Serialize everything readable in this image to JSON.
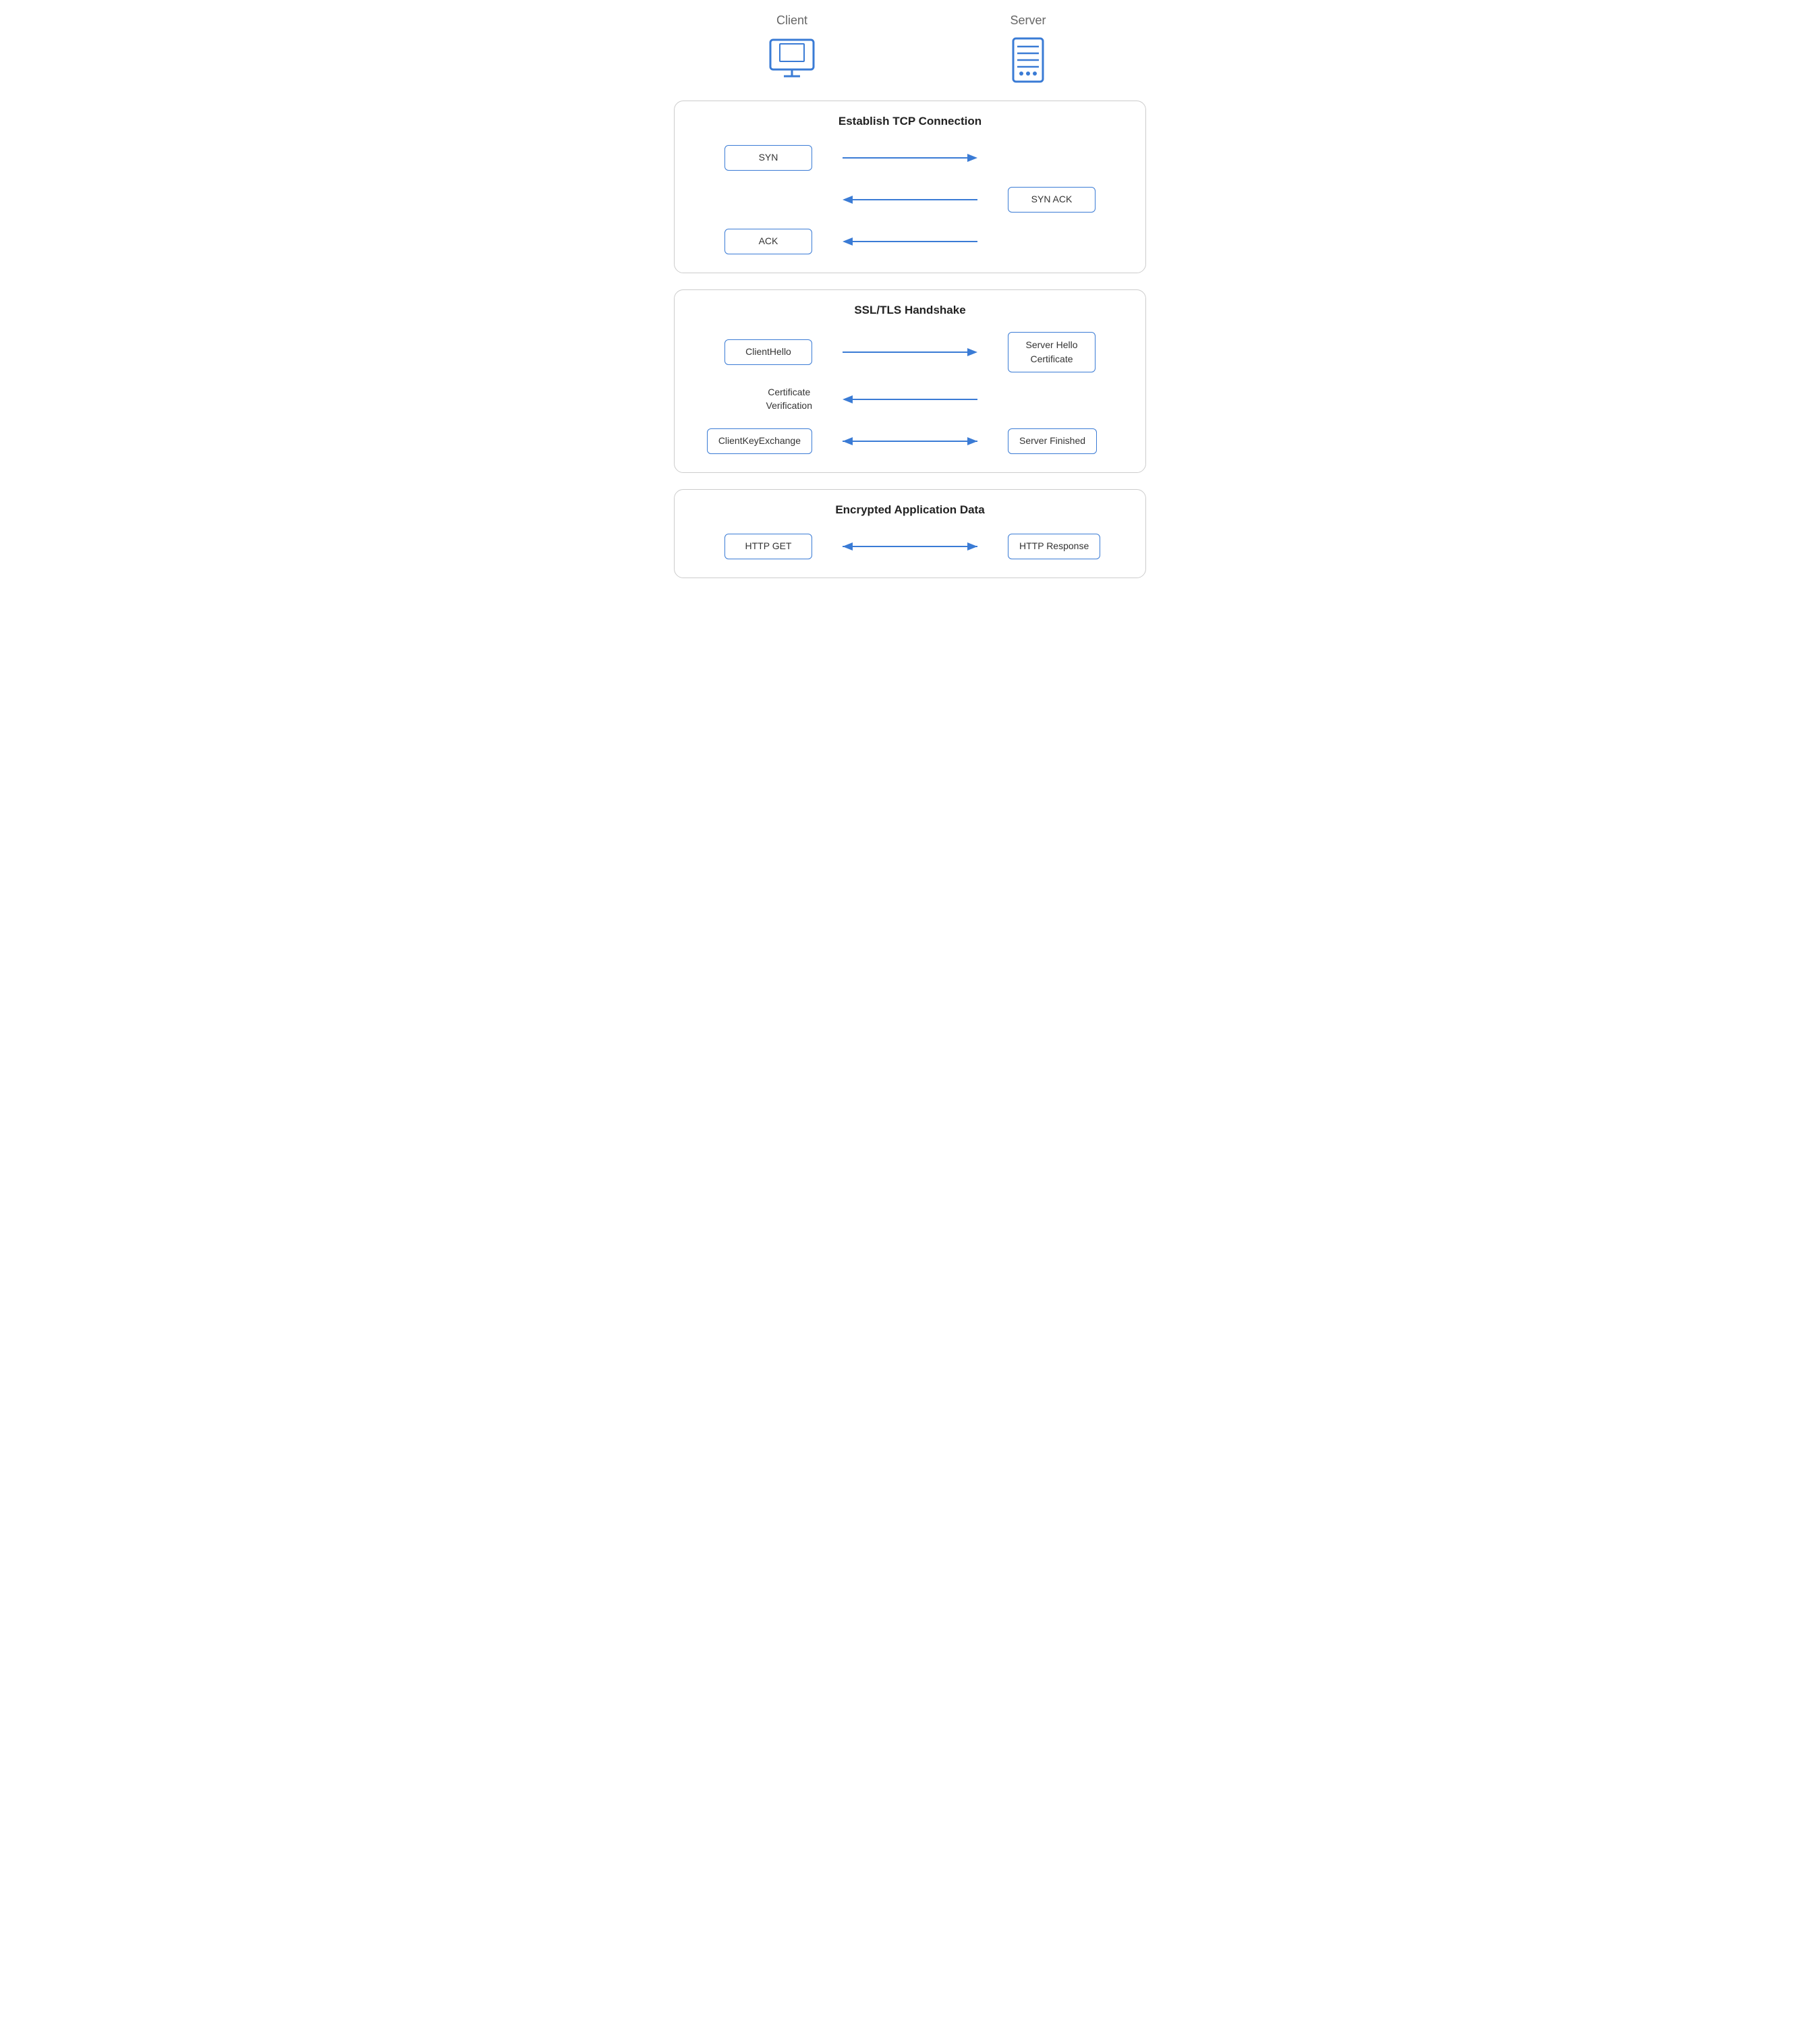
{
  "entities": {
    "client": {
      "label": "Client",
      "icon": "monitor"
    },
    "server": {
      "label": "Server",
      "icon": "server"
    }
  },
  "sections": [
    {
      "id": "tcp",
      "title": "Establish TCP Connection",
      "rows": [
        {
          "left_type": "box",
          "left_text": "SYN",
          "arrow_direction": "right",
          "right_type": "none",
          "right_text": ""
        },
        {
          "left_type": "none",
          "left_text": "",
          "arrow_direction": "left",
          "right_type": "box",
          "right_text": "SYN ACK"
        },
        {
          "left_type": "box",
          "left_text": "ACK",
          "arrow_direction": "left",
          "right_type": "none",
          "right_text": ""
        }
      ]
    },
    {
      "id": "tls",
      "title": "SSL/TLS Handshake",
      "rows": [
        {
          "left_type": "box",
          "left_text": "ClientHello",
          "arrow_direction": "right",
          "right_type": "box",
          "right_text": "Server Hello\nCertificate"
        },
        {
          "left_type": "text",
          "left_text": "Certificate\nVerification",
          "arrow_direction": "left",
          "right_type": "none",
          "right_text": ""
        },
        {
          "left_type": "box",
          "left_text": "ClientKeyExchange",
          "arrow_direction": "both",
          "right_type": "box",
          "right_text": "Server Finished"
        }
      ]
    },
    {
      "id": "data",
      "title": "Encrypted Application Data",
      "rows": [
        {
          "left_type": "box",
          "left_text": "HTTP GET",
          "arrow_direction": "both",
          "right_type": "box",
          "right_text": "HTTP Response"
        }
      ]
    }
  ],
  "colors": {
    "blue": "#3a7bd5",
    "border": "#cccccc",
    "text_dark": "#222222",
    "text_gray": "#666666"
  }
}
